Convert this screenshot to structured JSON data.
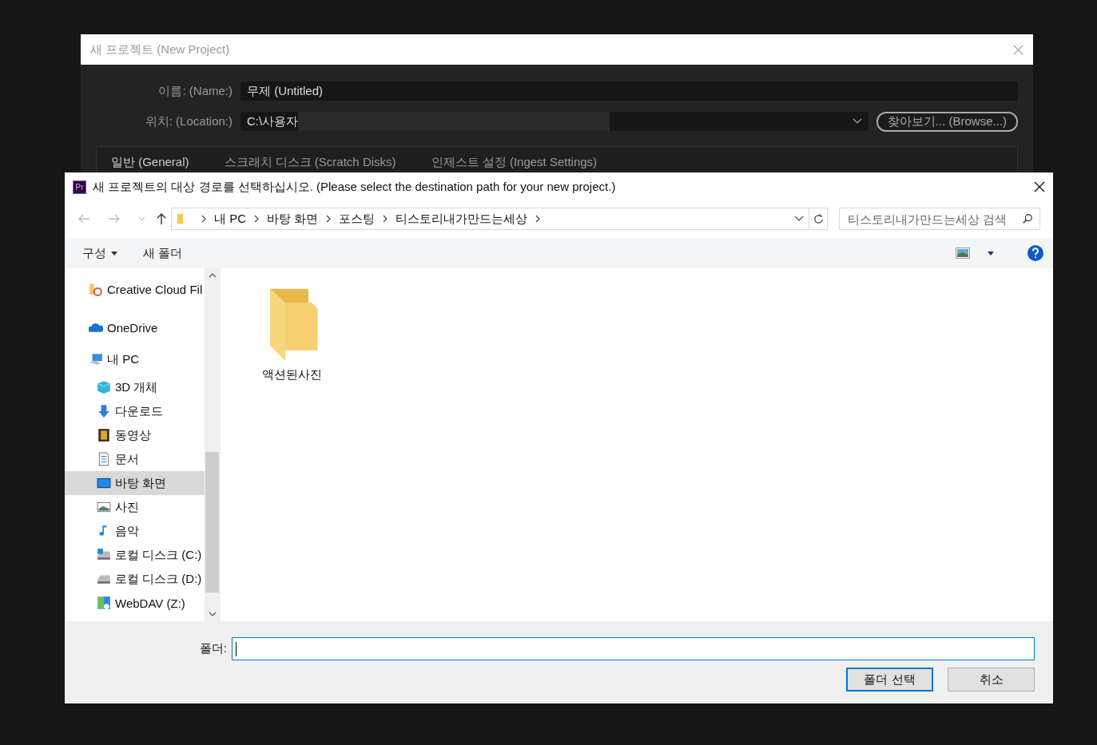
{
  "background_window": {
    "title": "새 프로젝트 (New Project)",
    "fields": [
      {
        "label": "이름: (Name:)",
        "value": "무제 (Untitled)"
      },
      {
        "label": "위치: (Location:)",
        "value": "C:\\사용자"
      }
    ],
    "browse_button": "찾아보기... (Browse...)",
    "tabs": [
      {
        "label": "일반 (General)",
        "selected": true
      },
      {
        "label": "스크래치 디스크 (Scratch Disks)",
        "selected": false
      },
      {
        "label": "인제스트 설정 (Ingest Settings)",
        "selected": false
      }
    ]
  },
  "dialog": {
    "app_badge": "Pr",
    "title": "새 프로젝트의 대상 경로를 선택하십시오. (Please select the destination path for your new project.)",
    "breadcrumbs": [
      "내 PC",
      "바탕 화면",
      "포스팅",
      "티스토리내가만드는세상"
    ],
    "search": {
      "placeholder": "티스토리내가만드는세상 검색"
    },
    "toolbar": [
      "구성",
      "새 폴더"
    ],
    "nav": [
      {
        "label": "Creative Cloud Fil",
        "selected": false
      },
      {
        "label": "OneDrive",
        "selected": false
      },
      {
        "label": "내 PC",
        "selected": false,
        "children": [
          {
            "label": "3D 개체",
            "selected": false
          },
          {
            "label": "다운로드",
            "selected": false
          },
          {
            "label": "동영상",
            "selected": false
          },
          {
            "label": "문서",
            "selected": false
          },
          {
            "label": "바탕 화면",
            "selected": true
          },
          {
            "label": "사진",
            "selected": false
          },
          {
            "label": "음악",
            "selected": false
          },
          {
            "label": "로컬 디스크 (C:)",
            "selected": false
          },
          {
            "label": "로컬 디스크 (D:)",
            "selected": false
          },
          {
            "label": "WebDAV (Z:)",
            "selected": false
          }
        ]
      }
    ],
    "items": [
      {
        "name": "액션된사진"
      }
    ],
    "folder_label": "폴더:",
    "buttons": [
      {
        "label": "폴더 선택",
        "default": true
      },
      {
        "label": "취소",
        "default": false
      }
    ]
  }
}
